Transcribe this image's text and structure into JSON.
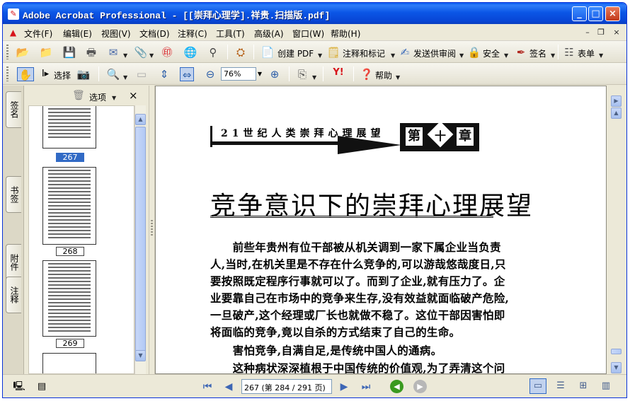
{
  "window": {
    "title": "Adobe Acrobat Professional - [[崇拜心理学].祥贵.扫描版.pdf]",
    "minimize": "_",
    "maximize": "□",
    "close": "×"
  },
  "menu": {
    "items": [
      "文件(F)",
      "编辑(E)",
      "视图(V)",
      "文档(D)",
      "注释(C)",
      "工具(T)",
      "高级(A)",
      "窗口(W)",
      "帮助(H)"
    ],
    "mdi_min": "–",
    "mdi_restore": "❐",
    "mdi_close": "×"
  },
  "toolbar1": {
    "create_pdf": "创建 PDF",
    "comment_markup": "注释和标记",
    "send_review": "发送供审阅",
    "security": "安全",
    "sign": "签名",
    "forms": "表单"
  },
  "toolbar2": {
    "select": "选择",
    "zoom_value": "76%",
    "help": "帮助"
  },
  "nav": {
    "tabs": [
      "签名",
      "书签",
      "附件",
      "注释"
    ],
    "options": "选项",
    "close": "×",
    "thumbnails": [
      {
        "label": "267",
        "selected": true
      },
      {
        "label": "268",
        "selected": false
      },
      {
        "label": "269",
        "selected": false
      }
    ]
  },
  "page": {
    "header_text": "21世纪人类崇拜心理展望",
    "chapter_prefix": "第",
    "chapter_num": "十",
    "chapter_suffix": "章",
    "title": "竞争意识下的崇拜心理展望",
    "lines": [
      "　　前些年贵州有位干部被从机关调到一家下属企业当负责",
      "人,当时,在机关里是不存在什么竞争的,可以游哉悠哉度日,只",
      "要按照既定程序行事就可以了。而到了企业,就有压力了。企",
      "业要靠自己在市场中的竞争来生存,没有效益就面临破产危险,",
      "一旦破产,这个经理或厂长也就做不稳了。这位干部因害怕即",
      "将面临的竞争,竟以自杀的方式结束了自己的生命。",
      "　　害怕竞争,自满自足,是传统中国人的通病。",
      "　　这种病状深深植根于中国传统的价值观,为了弄清这个问"
    ]
  },
  "status": {
    "page_field": "267 (第 284 / 291 页)"
  }
}
